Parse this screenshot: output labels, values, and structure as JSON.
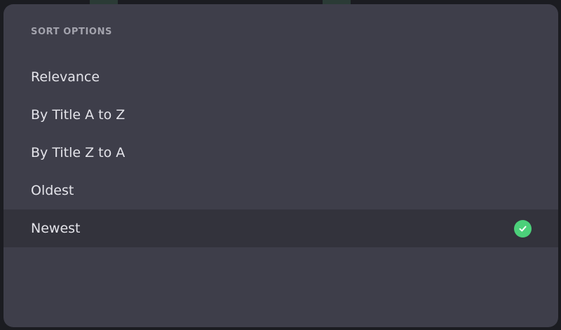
{
  "sort_sheet": {
    "title": "SORT OPTIONS",
    "options": [
      {
        "label": "Relevance",
        "selected": false
      },
      {
        "label": "By Title A to Z",
        "selected": false
      },
      {
        "label": "By Title Z to A",
        "selected": false
      },
      {
        "label": "Oldest",
        "selected": false
      },
      {
        "label": "Newest",
        "selected": true
      }
    ],
    "selected_icon": "check-circle-icon",
    "check_color": "#4cd07a"
  }
}
